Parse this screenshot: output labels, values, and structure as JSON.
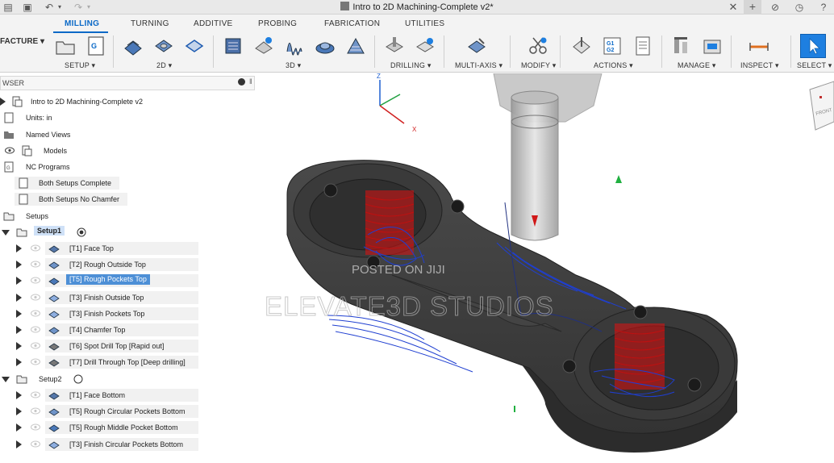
{
  "window": {
    "title": "Intro to 2D Machining-Complete v2*"
  },
  "ribbon": {
    "workspace": "FACTURE",
    "tabs": [
      "MILLING",
      "TURNING",
      "ADDITIVE",
      "PROBING",
      "FABRICATION",
      "UTILITIES"
    ],
    "groups": [
      "SETUP",
      "2D",
      "3D",
      "DRILLING",
      "MULTI-AXIS",
      "MODIFY",
      "ACTIONS",
      "MANAGE",
      "INSPECT",
      "SELECT"
    ]
  },
  "browser": {
    "header": "WSER",
    "root": "Intro to 2D Machining-Complete v2",
    "units": "Units: in",
    "named_views": "Named Views",
    "models": "Models",
    "nc_programs": "NC Programs",
    "nc_items": [
      "Both Setups Complete",
      "Both Setups No Chamfer"
    ],
    "setups": "Setups",
    "setup1": {
      "label": "Setup1",
      "ops": [
        "[T1] Face Top",
        "[T2] Rough Outside  Top",
        "[T5] Rough Pockets Top",
        "[T3] Finish Outside Top",
        "[T3] Finish Pockets Top",
        "[T4] Chamfer Top",
        "[T6] Spot Drill Top [Rapid out]",
        "[T7] Drill Through Top [Deep drilling]"
      ]
    },
    "setup2": {
      "label": "Setup2",
      "ops": [
        "[T1] Face Bottom",
        "[T5] Rough Circular Pockets Bottom",
        "[T5] Rough  Middle Pocket Bottom",
        "[T3] Finish Circular Pockets Bottom"
      ]
    }
  },
  "viewport": {
    "axis_labels": [
      "Z",
      "X"
    ],
    "view_cube_label": "FRONT",
    "watermark_small": "POSTED ON JIJI",
    "watermark_large": "ELEVATE3D STUDIOS"
  },
  "colors": {
    "accent": "#0a69c7",
    "selection": "#4d8fd6",
    "toolpath": "#1f3fd1",
    "stock_red": "#e01010",
    "part_dark": "#3c3c3c"
  }
}
